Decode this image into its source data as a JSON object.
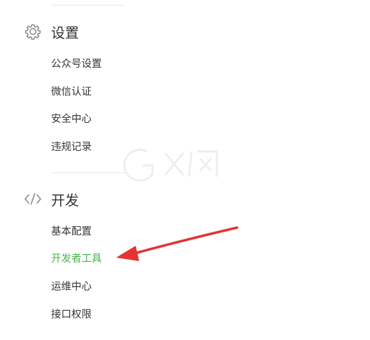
{
  "sections": [
    {
      "title": "设置",
      "icon": "gear-icon",
      "items": [
        {
          "label": "公众号设置"
        },
        {
          "label": "微信认证"
        },
        {
          "label": "安全中心"
        },
        {
          "label": "违规记录"
        }
      ]
    },
    {
      "title": "开发",
      "icon": "code-icon",
      "items": [
        {
          "label": "基本配置"
        },
        {
          "label": "开发者工具",
          "active": true
        },
        {
          "label": "运维中心"
        },
        {
          "label": "接口权限"
        }
      ]
    }
  ],
  "colors": {
    "active_text": "#44b549",
    "annotation_arrow": "#e53232",
    "icon": "#8d8d8d",
    "divider": "#e7e7eb"
  }
}
